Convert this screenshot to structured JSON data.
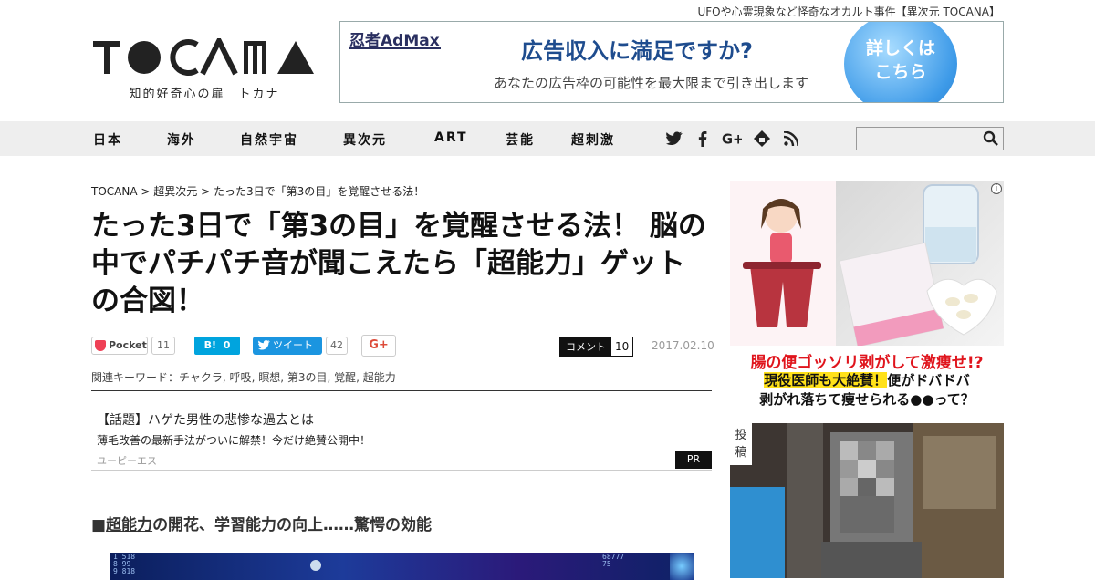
{
  "header": {
    "tagline": "UFOや心霊現象など怪奇なオカルト事件【異次元 TOCANA】",
    "logo_text": "TOCANA",
    "logo_sub": "知的好奇心の扉　トカナ"
  },
  "banner": {
    "brand": "忍者AdMax",
    "headline": "広告収入に満足ですか?",
    "sub": "あなたの広告枠の可能性を最大限まで引き出します",
    "cta_line1": "詳しくは",
    "cta_line2": "こちら"
  },
  "nav": {
    "items": [
      "日本",
      "海外",
      "自然宇宙",
      "異次元",
      "ART",
      "芸能",
      "超刺激"
    ],
    "social_icons": [
      "twitter-icon",
      "facebook-icon",
      "google-plus-icon",
      "feedly-icon",
      "rss-icon"
    ],
    "search_value": ""
  },
  "breadcrumb": {
    "items": [
      "TOCANA",
      "超異次元",
      "たった3日で「第3の目」を覚醒させる法！"
    ],
    "sep": " > "
  },
  "article": {
    "title": "たった3日で「第3の目」を覚醒させる法！ 脳の中でパチパチ音が聞こえたら「超能力」ゲットの合図！",
    "date": "2017.02.10",
    "keywords_label": "関連キーワード：",
    "keywords": [
      "チャクラ",
      "呼吸",
      "瞑想",
      "第3の目",
      "覚醒",
      "超能力"
    ],
    "section_prefix": "■",
    "section_link": "超能力",
    "section_rest": "の開花、学習能力の向上……驚愕の効能"
  },
  "share": {
    "pocket_label": "Pocket",
    "pocket_count": "11",
    "hatena_label": "B!",
    "hatena_count": "0",
    "tweet_label": "ツイート",
    "tweet_count": "42",
    "gplus_label": "G+",
    "comment_label": "コメント",
    "comment_count": "10"
  },
  "pr": {
    "title": "【話題】ハゲた男性の悲惨な過去とは",
    "desc": "薄毛改善の最新手法がついに解禁！今だけ絶賛公開中！",
    "sponsor": "ユーピーエス",
    "badge": "PR"
  },
  "sidebar": {
    "ad1_line1": "腸の便ゴッソリ剥がして激痩せ!?",
    "ad1_line2_highlight": "現役医師も大絶賛！",
    "ad1_line2_rest": "便がドバドバ",
    "ad1_line3": "剥がれ落ちて痩せられる●●って？",
    "ad2_tag": "投稿"
  },
  "colors": {
    "nav_bg": "#eeeeee",
    "hatena": "#00a4de",
    "twitter": "#1b95e0",
    "pocket": "#ef4056",
    "ad_red": "#e0151d"
  }
}
